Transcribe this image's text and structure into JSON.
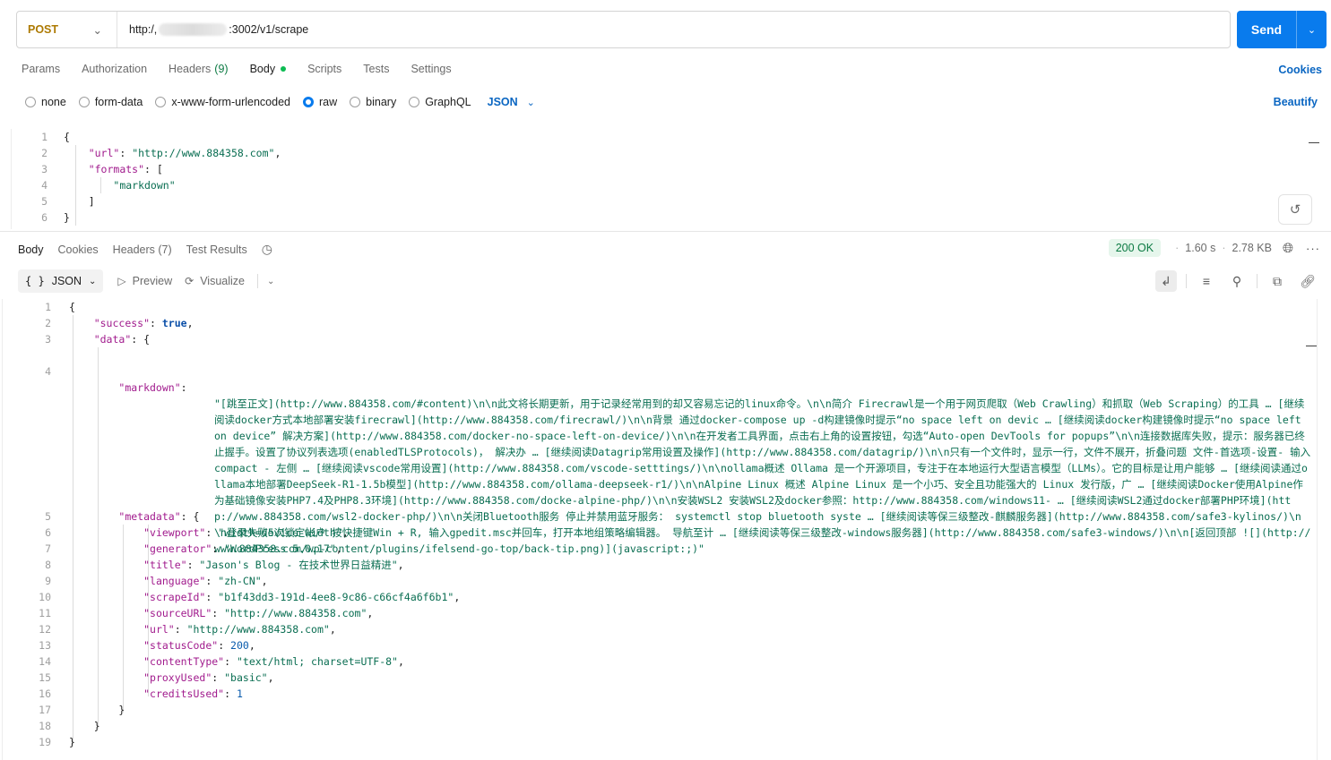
{
  "request": {
    "method": "POST",
    "url_prefix": "http:/,",
    "url_suffix": ":3002/v1/scrape",
    "send_label": "Send"
  },
  "request_tabs": [
    {
      "label": "Params"
    },
    {
      "label": "Authorization"
    },
    {
      "label": "Headers",
      "count": "(9)"
    },
    {
      "label": "Body"
    },
    {
      "label": "Scripts"
    },
    {
      "label": "Tests"
    },
    {
      "label": "Settings"
    }
  ],
  "cookies_label": "Cookies",
  "body_types": [
    "none",
    "form-data",
    "x-www-form-urlencoded",
    "raw",
    "binary",
    "GraphQL"
  ],
  "selected_body_type": "raw",
  "raw_format": "JSON",
  "beautify_label": "Beautify",
  "request_body": {
    "url_key": "\"url\"",
    "url_value": "\"http://www.884358.com\"",
    "formats_key": "\"formats\"",
    "formats_item": "\"markdown\""
  },
  "response_tabs": [
    {
      "label": "Body"
    },
    {
      "label": "Cookies"
    },
    {
      "label": "Headers (7)"
    },
    {
      "label": "Test Results"
    }
  ],
  "response_status": {
    "code": "200 OK",
    "time": "1.60 s",
    "size": "2.78 KB"
  },
  "response_toolbar": {
    "format": "JSON",
    "preview": "Preview",
    "visualize": "Visualize"
  },
  "response_body": {
    "success_key": "\"success\"",
    "success_value": "true",
    "data_key": "\"data\"",
    "markdown_key": "\"markdown\"",
    "markdown_value": "\"[跳至正文](http://www.884358.com/#content)\\n\\n此文将长期更新，用于记录经常用到的却又容易忘记的linux命令。\\n\\n简介 Firecrawl是一个用于网页爬取（Web Crawling）和抓取（Web Scraping）的工具 … [继续阅读docker方式本地部署安装firecrawl](http://www.884358.com/firecrawl/)\\n\\n背景 通过docker-compose up -d构建镜像时提示“no space left on devic … [继续阅读docker构建镜像时提示“no space left on device” 解决方案](http://www.884358.com/docker-no-space-left-on-device/)\\n\\n在开发者工具界面，点击右上角的设置按钮，勾选“Auto-open DevTools for popups”\\n\\n连接数据库失败，提示：服务器已终止握手。设置了协议列表选项(enabledTLSProtocols)， 解决办 … [继续阅读Datagrip常用设置及操作](http://www.884358.com/datagrip/)\\n\\n只有一个文件时，显示一行，文件不展开，折叠问题 文件-首选项-设置- 输入 compact - 左侧 … [继续阅读vscode常用设置](http://www.884358.com/vscode-setttings/)\\n\\nollama概述 Ollama 是一个开源项目，专注于在本地运行大型语言模型（LLMs）。它的目标是让用户能够 … [继续阅读通过ollama本地部署DeepSeek-R1-1.5b模型](http://www.884358.com/ollama-deepseek-r1/)\\n\\nAlpine Linux 概述 Alpine Linux 是一个小巧、安全且功能强大的 Linux 发行版，广 … [继续阅读Docker使用Alpine作为基础镜像安装PHP7.4及PHP8.3环境](http://www.884358.com/docke-alpine-php/)\\n\\n安装WSL2 安装WSL2及docker参照：http://www.884358.com/windows11- … [继续阅读WSL2通过docker部署PHP环境](http://www.884358.com/wsl2-docker-php/)\\n\\n关闭Bluetooth服务 停止并禁用蓝牙服务： systemctl stop bluetooth syste … [继续阅读等保三级整改-麒麟服务器](http://www.884358.com/safe3-kylinos/)\\n\\n登录失败5次锁定帐户 按快捷键Win + R, 输入gpedit.msc并回车，打开本地组策略编辑器。 导航至计 … [继续阅读等保三级整改-windows服务器](http://www.884358.com/safe3-windows/)\\n\\n[返回顶部 ![](http://www.884358.com/wp-content/plugins/ifelsend-go-top/back-tip.png)](javascript:;)\"",
    "metadata_key": "\"metadata\"",
    "metadata": [
      {
        "key": "\"viewport\"",
        "value": "\"width=device-width\"",
        "type": "str"
      },
      {
        "key": "\"generator\"",
        "value": "\"WordPress 5.0.17\"",
        "type": "str"
      },
      {
        "key": "\"title\"",
        "value": "\"Jason's Blog - 在技术世界日益精进\"",
        "type": "str"
      },
      {
        "key": "\"language\"",
        "value": "\"zh-CN\"",
        "type": "str"
      },
      {
        "key": "\"scrapeId\"",
        "value": "\"b1f43dd3-191d-4ee8-9c86-c66cf4a6f6b1\"",
        "type": "str"
      },
      {
        "key": "\"sourceURL\"",
        "value": "\"http://www.884358.com\"",
        "type": "str"
      },
      {
        "key": "\"url\"",
        "value": "\"http://www.884358.com\"",
        "type": "str"
      },
      {
        "key": "\"statusCode\"",
        "value": "200",
        "type": "num"
      },
      {
        "key": "\"contentType\"",
        "value": "\"text/html; charset=UTF-8\"",
        "type": "str"
      },
      {
        "key": "\"proxyUsed\"",
        "value": "\"basic\"",
        "type": "str"
      },
      {
        "key": "\"creditsUsed\"",
        "value": "1",
        "type": "num"
      }
    ]
  },
  "icons": [
    "chevron-down-icon",
    "history-icon",
    "globe-icon",
    "more-icon",
    "play-icon",
    "visualize-icon",
    "wrap-icon",
    "filter-icon",
    "search-icon",
    "copy-icon",
    "link-icon"
  ],
  "colors": {
    "send": "#097bed",
    "method": "#ad7a03",
    "status_ok": "#0c7a43",
    "link": "#0a66c2"
  }
}
